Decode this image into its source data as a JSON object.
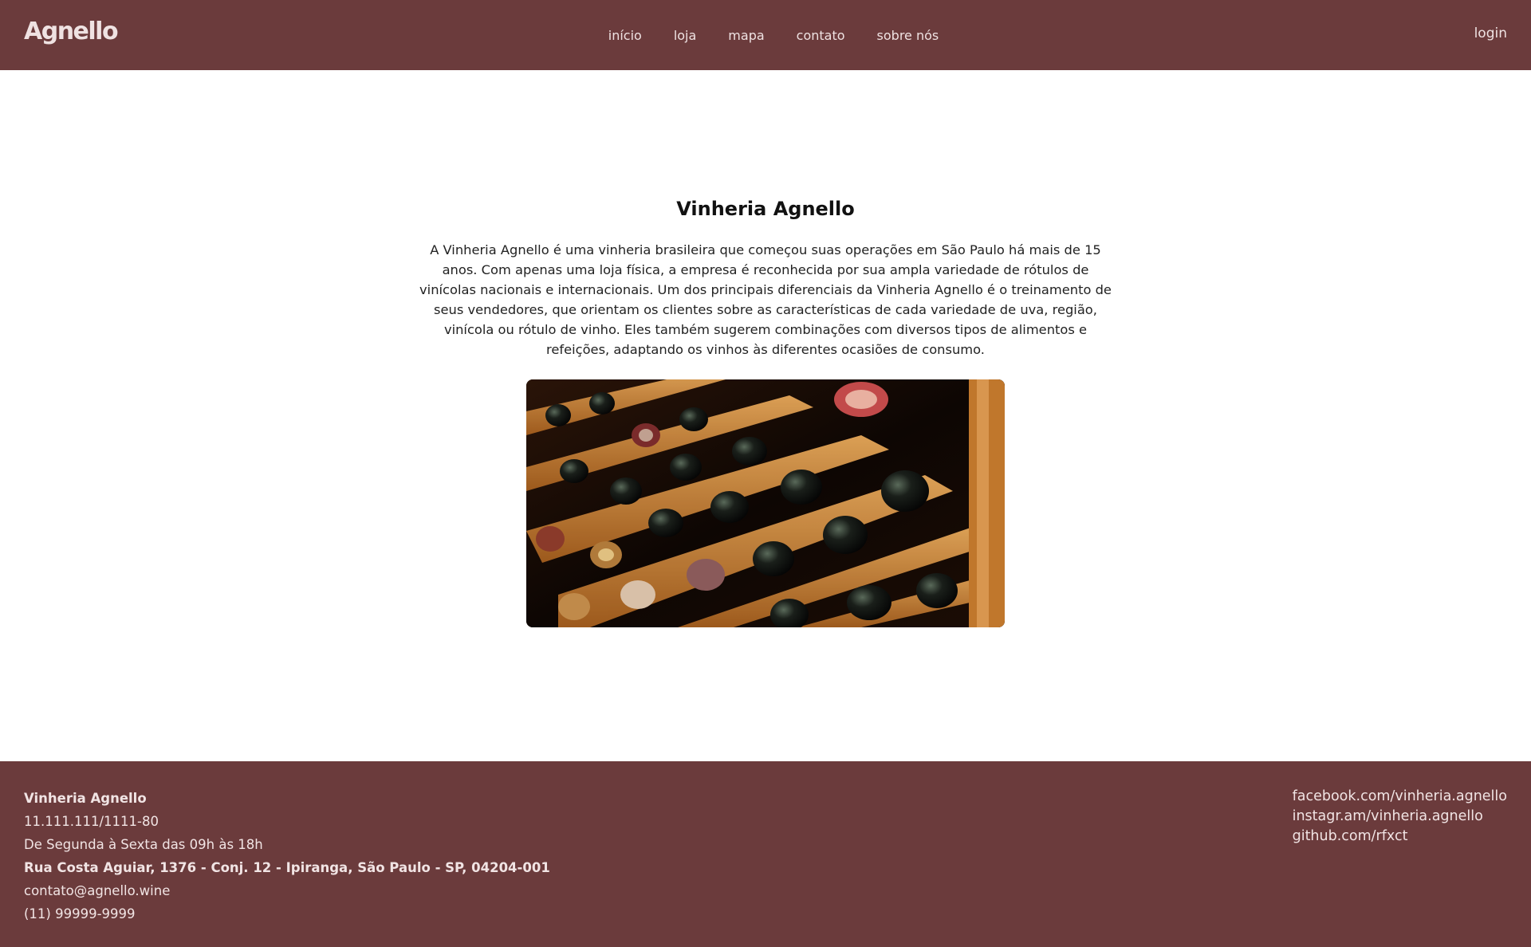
{
  "header": {
    "logo": "Agnello",
    "nav": [
      "início",
      "loja",
      "mapa",
      "contato",
      "sobre nós"
    ],
    "login": "login"
  },
  "about": {
    "title": "Vinheria Agnello",
    "text": "A Vinheria Agnello é uma vinheria brasileira que começou suas operações em São Paulo há mais de 15 anos. Com apenas uma loja física, a empresa é reconhecida por sua ampla variedade de rótulos de vinícolas nacionais e internacionais. Um dos principais diferenciais da Vinheria Agnello é o treinamento de seus vendedores, que orientam os clientes sobre as características de cada variedade de uva, região, vinícola ou rótulo de vinho. Eles também sugerem combinações com diversos tipos de alimentos e refeições, adaptando os vinhos às diferentes ocasiões de consumo."
  },
  "footer": {
    "name": "Vinheria Agnello",
    "cnpj": "11.111.111/1111-80",
    "hours": "De Segunda à Sexta das 09h às 18h",
    "address": "Rua Costa Aguiar, 1376 - Conj. 12 - Ipiranga, São Paulo - SP, 04204-001",
    "email": "contato@agnello.wine",
    "phone": "(11) 99999-9999",
    "social": [
      "facebook.com/vinheria.agnello",
      "instagr.am/vinheria.agnello",
      "github.com/rfxct"
    ]
  },
  "colors": {
    "brand": "#6b3b3c",
    "brand_text": "#efe2e2"
  },
  "icons": {
    "photo": "wine-rack-image"
  }
}
